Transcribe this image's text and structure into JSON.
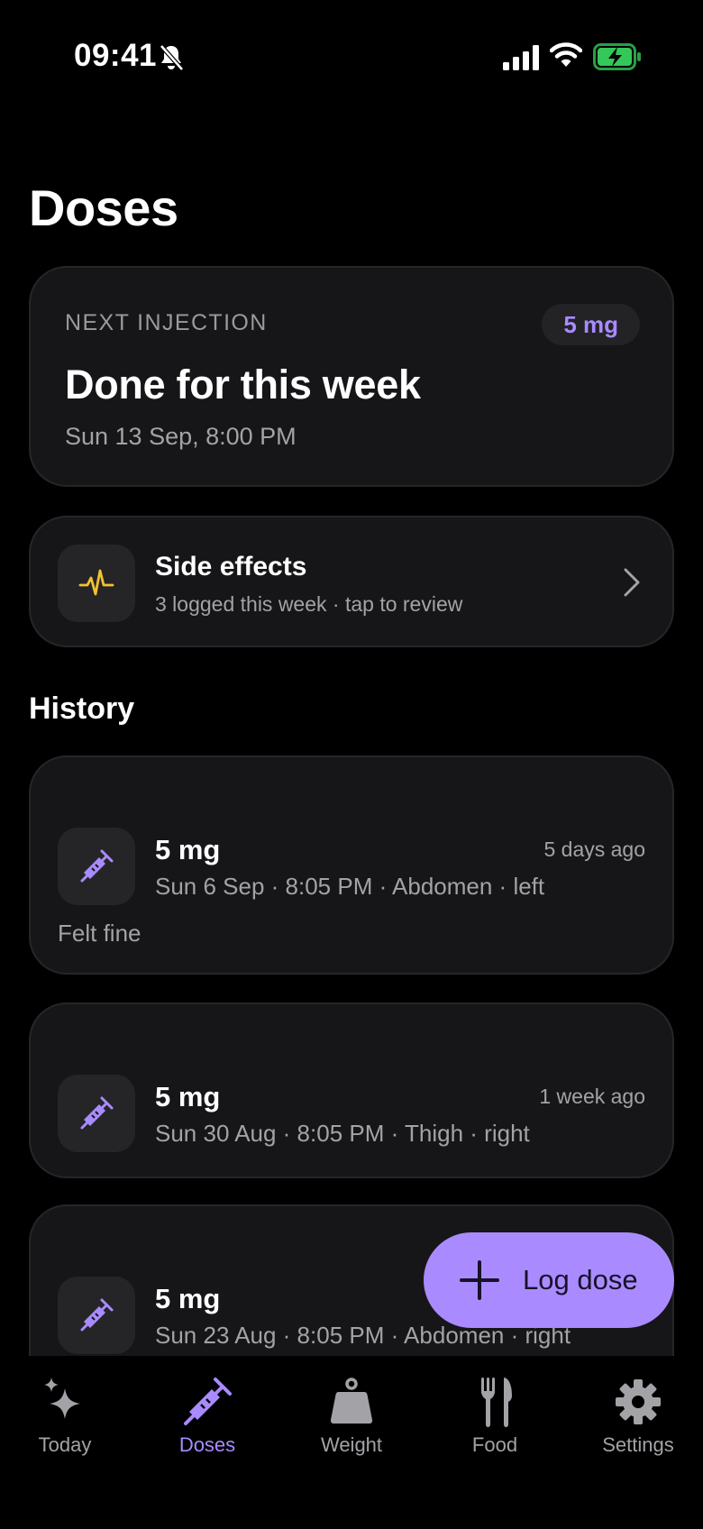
{
  "status_bar": {
    "time": "09:41"
  },
  "page": {
    "title": "Doses"
  },
  "next_injection": {
    "label": "NEXT INJECTION",
    "dose_badge": "5 mg",
    "title": "Done for this week",
    "date": "Sun 13 Sep, 8:00 PM"
  },
  "side_effects": {
    "title": "Side effects",
    "subtitle": "3 logged this week · tap to review"
  },
  "history": {
    "title": "History",
    "items": [
      {
        "amount": "5 mg",
        "when": "5 days ago",
        "detail": "Sun 6 Sep · 8:05 PM · Abdomen · left",
        "note": "Felt fine"
      },
      {
        "amount": "5 mg",
        "when": "1 week ago",
        "detail": "Sun 30 Aug · 8:05 PM · Thigh · right"
      },
      {
        "amount": "5 mg",
        "detail": "Sun 23 Aug · 8:05 PM · Abdomen · right"
      }
    ]
  },
  "fab": {
    "label": "Log dose"
  },
  "tabs": [
    {
      "label": "Today",
      "icon": "sparkles-icon"
    },
    {
      "label": "Doses",
      "icon": "syringe-icon",
      "active": true
    },
    {
      "label": "Weight",
      "icon": "weight-icon"
    },
    {
      "label": "Food",
      "icon": "fork-knife-icon"
    },
    {
      "label": "Settings",
      "icon": "gear-icon"
    }
  ],
  "colors": {
    "accent": "#a98bff",
    "side_effect_icon": "#f2c230",
    "battery": "#34c759"
  }
}
